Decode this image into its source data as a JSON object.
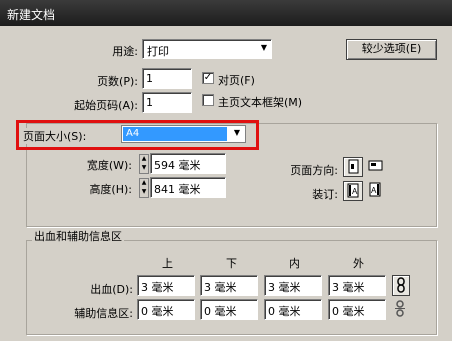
{
  "window": {
    "title": "新建文档"
  },
  "purpose": {
    "label": "用途:",
    "value": "打印"
  },
  "fewer_options_button": "较少选项(E)",
  "pages": {
    "label": "页数(P):",
    "value": "1"
  },
  "facing_pages": {
    "label": "对页(F)",
    "checked": true
  },
  "start_page": {
    "label": "起始页码(A):",
    "value": "1"
  },
  "master_text_frame": {
    "label": "主页文本框架(M)",
    "checked": false
  },
  "page_size": {
    "label": "页面大小(S):",
    "value": "A4"
  },
  "width": {
    "label": "宽度(W):",
    "value": "594 毫米"
  },
  "height": {
    "label": "高度(H):",
    "value": "841 毫米"
  },
  "orientation": {
    "label": "页面方向:"
  },
  "binding": {
    "label": "装订:"
  },
  "bleed_section": {
    "title": "出血和辅助信息区",
    "columns": [
      "上",
      "下",
      "内",
      "外"
    ],
    "bleed": {
      "label": "出血(D):",
      "values": [
        "3 毫米",
        "3 毫米",
        "3 毫米",
        "3 毫米"
      ]
    },
    "slug": {
      "label": "辅助信息区:",
      "values": [
        "0 毫米",
        "0 毫米",
        "0 毫米",
        "0 毫米"
      ]
    }
  },
  "colors": {
    "highlight": "#3399ff",
    "callout": "#e01010"
  }
}
